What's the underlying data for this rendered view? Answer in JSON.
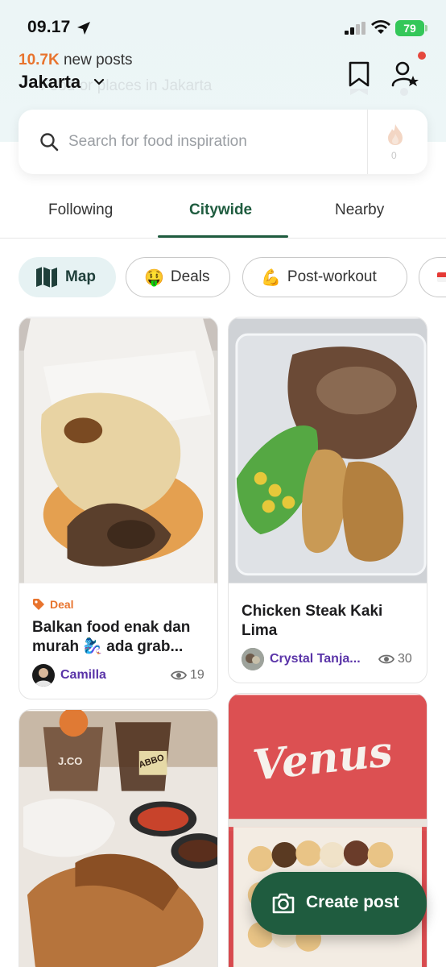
{
  "status_bar": {
    "time": "09.17",
    "battery": "79"
  },
  "header": {
    "new_posts_count": "10.7K",
    "new_posts_label": "new posts",
    "city": "Jakarta",
    "background_hint": "Food or places in Jakarta"
  },
  "search": {
    "placeholder": "Search for food inspiration",
    "flame_count": "0"
  },
  "tabs": [
    {
      "label": "Following",
      "active": false
    },
    {
      "label": "Citywide",
      "active": true
    },
    {
      "label": "Nearby",
      "active": false
    }
  ],
  "chips": [
    {
      "label": "Map",
      "icon": "map-icon"
    },
    {
      "label": "Deals",
      "icon": "money-face-emoji"
    },
    {
      "label": "Post-workout",
      "icon": "flexed-biceps-emoji"
    }
  ],
  "cards": [
    {
      "deal": "Deal",
      "title": "Balkan food enak dan murah 🧞‍♀️ ada grab...",
      "author": "Camilla",
      "views": "19"
    },
    {
      "title": "Chicken Steak Kaki Lima",
      "author": "Crystal Tanja...",
      "views": "30"
    },
    {
      "image_text": [
        "J.CO",
        "ABBO"
      ]
    },
    {
      "image_text": [
        "Venus"
      ]
    }
  ],
  "fab": {
    "label": "Create post"
  },
  "colors": {
    "accent": "#1f5c3f",
    "orange": "#e8742e",
    "author": "#5a34a8"
  }
}
